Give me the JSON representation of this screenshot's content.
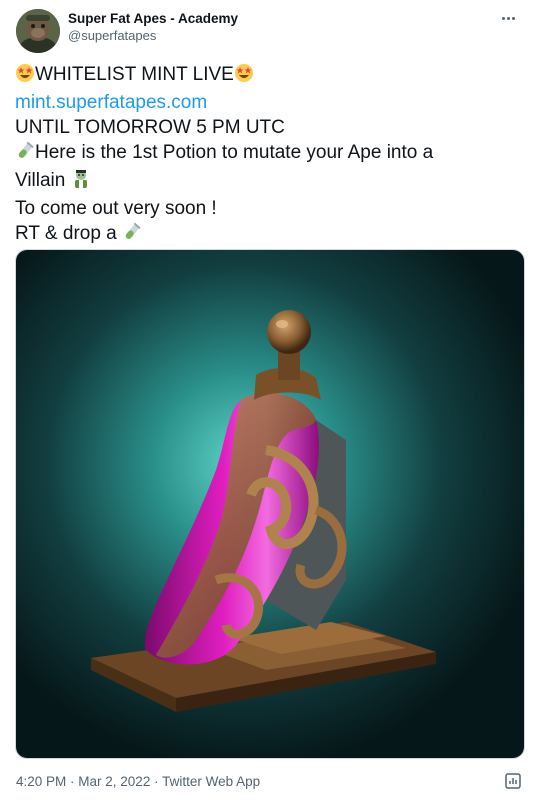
{
  "author": {
    "display_name": "Super Fat Apes - Academy",
    "handle": "@superfatapes"
  },
  "tweet": {
    "line1_text": "WHITELIST MINT LIVE",
    "line2_link": "mint.superfatapes.com",
    "line3_text": "UNTIL TOMORROW 5 PM UTC",
    "line4_text": "Here is the 1st Potion to mutate your Ape into a",
    "line5_text": "Villain",
    "line6_text": "To come out very soon !",
    "line7_text": "RT & drop a"
  },
  "meta": {
    "time": "4:20 PM",
    "sep1": " · ",
    "date": "Mar 2, 2022",
    "sep2": " · ",
    "source": "Twitter Web App"
  },
  "icons": {
    "star_struck": "star-struck-emoji",
    "test_tube": "test-tube-emoji",
    "zombie": "zombie-emoji",
    "more": "more-options-icon",
    "analytics": "tweet-analytics-icon"
  },
  "colors": {
    "link": "#1d9bf0",
    "secondary_text": "#536471",
    "border": "#cfd9de",
    "potion_liquid": "#e01ec0",
    "background_glow": "#2aa7a0"
  }
}
